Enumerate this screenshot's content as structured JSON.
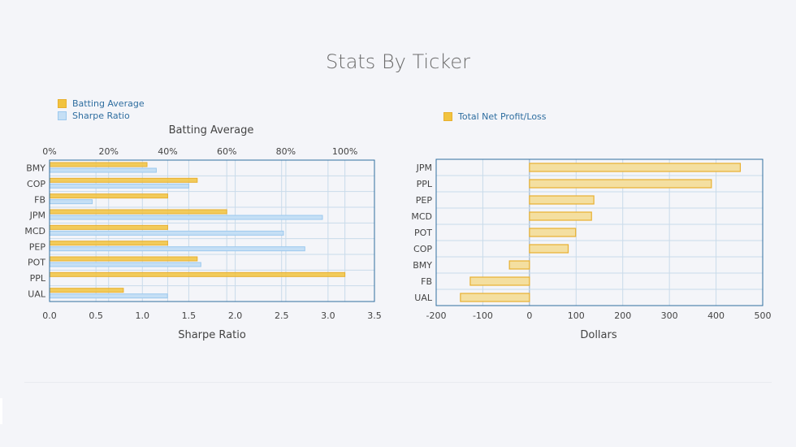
{
  "page_title": "Stats By Ticker",
  "legend_left": [
    {
      "label": "Batting Average",
      "color": "#f1c33f"
    },
    {
      "label": "Sharpe Ratio",
      "color": "#c5dff5"
    }
  ],
  "legend_right": [
    {
      "label": "Total Net Profit/Loss",
      "color": "#f1c33f"
    }
  ],
  "colors": {
    "accent_yellow": "#f1c33f",
    "yellow_border": "#e8b030",
    "light_blue": "#c5dff5",
    "blue_border": "#9cc9ee",
    "right_bar_fill": "#f4dfa0",
    "frame": "#2f6ea0"
  },
  "chart_data": [
    {
      "type": "bar",
      "orientation": "horizontal",
      "title": "",
      "top_axis_title": "Batting Average",
      "xlabel": "Sharpe Ratio",
      "categories": [
        "BMY",
        "COP",
        "FB",
        "JPM",
        "MCD",
        "PEP",
        "POT",
        "PPL",
        "UAL"
      ],
      "series": [
        {
          "name": "Batting Average",
          "axis": "top",
          "values": [
            0.33,
            0.5,
            0.4,
            0.6,
            0.4,
            0.4,
            0.5,
            1.0,
            0.25
          ]
        },
        {
          "name": "Sharpe Ratio",
          "axis": "bottom",
          "values": [
            1.15,
            1.5,
            0.46,
            2.94,
            2.52,
            2.75,
            1.63,
            0.0,
            1.27
          ]
        }
      ],
      "top_axis": {
        "range": [
          0,
          1.1
        ],
        "ticks": [
          0,
          0.2,
          0.4,
          0.6,
          0.8,
          1.0
        ],
        "tick_labels": [
          "0%",
          "20%",
          "40%",
          "60%",
          "80%",
          "100%"
        ]
      },
      "bottom_axis": {
        "range": [
          0,
          3.5
        ],
        "ticks": [
          0,
          0.5,
          1,
          1.5,
          2,
          2.5,
          3,
          3.5
        ],
        "tick_labels": [
          "0.0",
          "0.5",
          "1.0",
          "1.5",
          "2.0",
          "2.5",
          "3.0",
          "3.5"
        ]
      },
      "grid": true,
      "legend": "top-left"
    },
    {
      "type": "bar",
      "orientation": "horizontal",
      "title": "",
      "xlabel": "Dollars",
      "categories": [
        "JPM",
        "PPL",
        "PEP",
        "MCD",
        "POT",
        "COP",
        "BMY",
        "FB",
        "UAL"
      ],
      "series": [
        {
          "name": "Total Net Profit/Loss",
          "values": [
            452,
            390,
            138,
            133,
            99,
            83,
            -43,
            -127,
            -148
          ]
        }
      ],
      "x_axis": {
        "range": [
          -200,
          500
        ],
        "ticks": [
          -200,
          -100,
          0,
          100,
          200,
          300,
          400,
          500
        ],
        "tick_labels": [
          "-200",
          "-100",
          "0",
          "100",
          "200",
          "300",
          "400",
          "500"
        ]
      },
      "grid": true,
      "legend": "top-left"
    }
  ]
}
